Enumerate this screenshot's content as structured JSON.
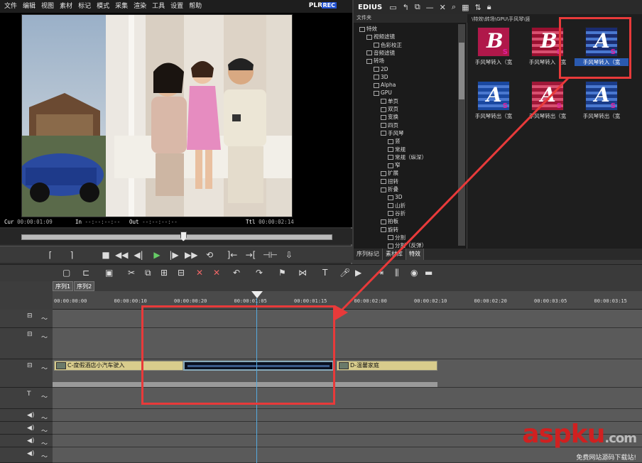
{
  "menubar": {
    "items": [
      "文件",
      "编辑",
      "视图",
      "素材",
      "标记",
      "模式",
      "采集",
      "渲染",
      "工具",
      "设置",
      "帮助"
    ],
    "plr": "PLR",
    "rec": "REC"
  },
  "preview": {
    "timecodes": {
      "cur_label": "Cur",
      "cur": "00:00:01:09",
      "in_label": "In",
      "in": "--:--:--:--",
      "out_label": "Out",
      "out": "--:--:--:--",
      "ttl_label": "Ttl",
      "ttl": "00:00:02:14"
    },
    "scrub_position": 0.52
  },
  "bin": {
    "title": "EDIUS",
    "folder_header": "文件夹",
    "path": "\\特效\\转场\\GPU\\手风琴\\竖",
    "tree": [
      {
        "label": "特效",
        "indent": 0
      },
      {
        "label": "视频滤镜",
        "indent": 1
      },
      {
        "label": "色彩校正",
        "indent": 2
      },
      {
        "label": "音频滤镜",
        "indent": 1
      },
      {
        "label": "转场",
        "indent": 1
      },
      {
        "label": "2D",
        "indent": 2
      },
      {
        "label": "3D",
        "indent": 2
      },
      {
        "label": "Alpha",
        "indent": 2
      },
      {
        "label": "GPU",
        "indent": 2
      },
      {
        "label": "单页",
        "indent": 3
      },
      {
        "label": "双页",
        "indent": 3
      },
      {
        "label": "变换",
        "indent": 3
      },
      {
        "label": "四页",
        "indent": 3
      },
      {
        "label": "手风琴",
        "indent": 3
      },
      {
        "label": "竖",
        "indent": 4
      },
      {
        "label": "常规",
        "indent": 4
      },
      {
        "label": "常规（纵深）",
        "indent": 4
      },
      {
        "label": "窄",
        "indent": 4
      },
      {
        "label": "扩展",
        "indent": 3
      },
      {
        "label": "扭转",
        "indent": 3
      },
      {
        "label": "折叠",
        "indent": 3
      },
      {
        "label": "3D",
        "indent": 4
      },
      {
        "label": "山折",
        "indent": 4
      },
      {
        "label": "谷折",
        "indent": 4
      },
      {
        "label": "拍板",
        "indent": 3
      },
      {
        "label": "旋转",
        "indent": 3
      },
      {
        "label": "分割",
        "indent": 4
      },
      {
        "label": "分割（反弹）",
        "indent": 4
      }
    ],
    "thumbnails": [
      {
        "letter": "B",
        "label": "手风琴转入（宽",
        "style": "red"
      },
      {
        "letter": "B",
        "label": "手风琴转入（宽",
        "style": "stripe-red"
      },
      {
        "letter": "A",
        "label": "手风琴转入（宽",
        "style": "selected"
      },
      {
        "letter": "A",
        "label": "手风琴转出（宽",
        "style": "stripe-blue"
      },
      {
        "letter": "A",
        "label": "手风琴转出（宽",
        "style": "stripe-red2"
      },
      {
        "letter": "A",
        "label": "手风琴转出（宽",
        "style": "stripe-blue2"
      }
    ],
    "tabs": [
      "序列标记",
      "素材库",
      "特效"
    ]
  },
  "timeline": {
    "sequence_tabs": [
      "序列1",
      "序列2"
    ],
    "ruler_marks": [
      "00:00:00:00",
      "00:00:00:10",
      "00:00:00:20",
      "00:00:01:05",
      "00:00:01:15",
      "00:00:02:00",
      "00:00:02:10",
      "00:00:02:20",
      "00:00:03:05",
      "00:00:03:15"
    ],
    "clips": [
      {
        "label": "C-度假酒店小汽车驶入"
      },
      {
        "label": "D-温馨家庭"
      }
    ]
  },
  "watermark": {
    "main": "aspku",
    "tld": ".com",
    "sub": "免费网站源码下载站!"
  },
  "colors": {
    "highlight_box": "#e83a3a",
    "clip_fill": "#d8cc8c",
    "rec_badge": "#2050d0"
  }
}
